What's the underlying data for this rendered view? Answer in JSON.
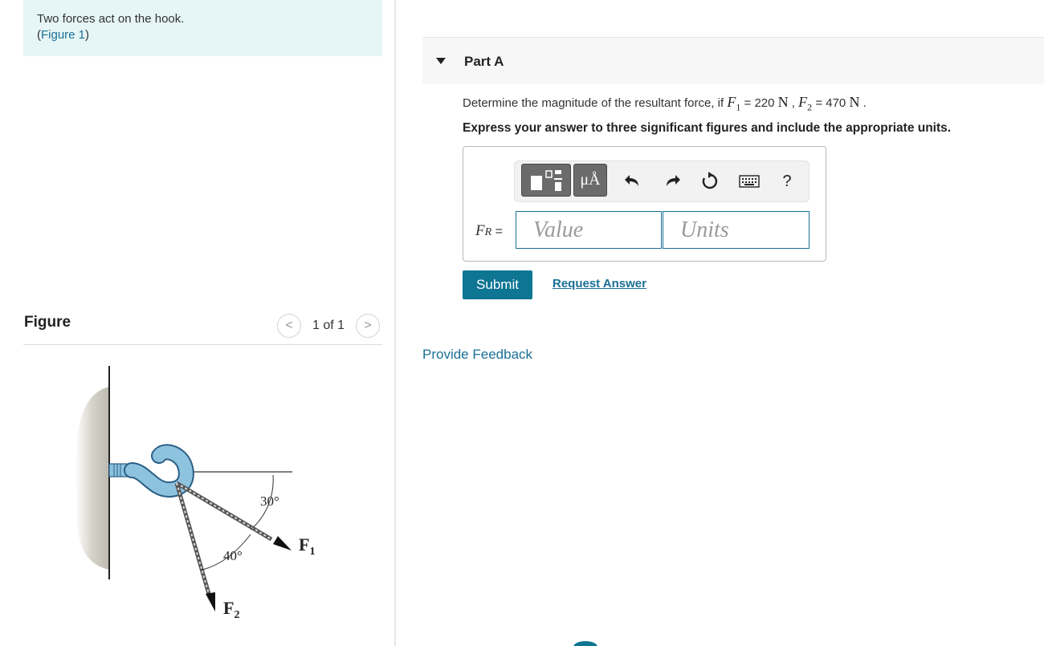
{
  "intro": {
    "text": "Two forces act on the hook.",
    "figure_link_open": "(",
    "figure_link": "Figure 1",
    "figure_link_close": ")"
  },
  "figure": {
    "title": "Figure",
    "pager_count": "1 of 1",
    "prev_glyph": "<",
    "next_glyph": ">",
    "angle1": "30°",
    "angle2": "40°",
    "force1_letter": "F",
    "force1_sub": "1",
    "force2_letter": "F",
    "force2_sub": "2"
  },
  "part": {
    "title": "Part A",
    "question_prefix": "Determine the magnitude of the resultant force, if ",
    "f1_symbol": "F",
    "f1_sub": "1",
    "f1_value": " = 220 ",
    "f1_unit": "N",
    "sep": " , ",
    "f2_symbol": "F",
    "f2_sub": "2",
    "f2_value": " = 470 ",
    "f2_unit": "N",
    "question_end": " .",
    "instruction": "Express your answer to three significant figures and include the appropriate units."
  },
  "answer": {
    "label_symbol": "F",
    "label_sub": "R",
    "label_eq": " =",
    "value_placeholder": "Value",
    "units_placeholder": "Units",
    "units_button": "μÅ",
    "help": "?"
  },
  "actions": {
    "submit": "Submit",
    "request_answer": "Request Answer",
    "provide_feedback": "Provide Feedback"
  },
  "colors": {
    "accent": "#0e7593",
    "link": "#1a6f95",
    "intro_bg": "#e6f5f6"
  }
}
